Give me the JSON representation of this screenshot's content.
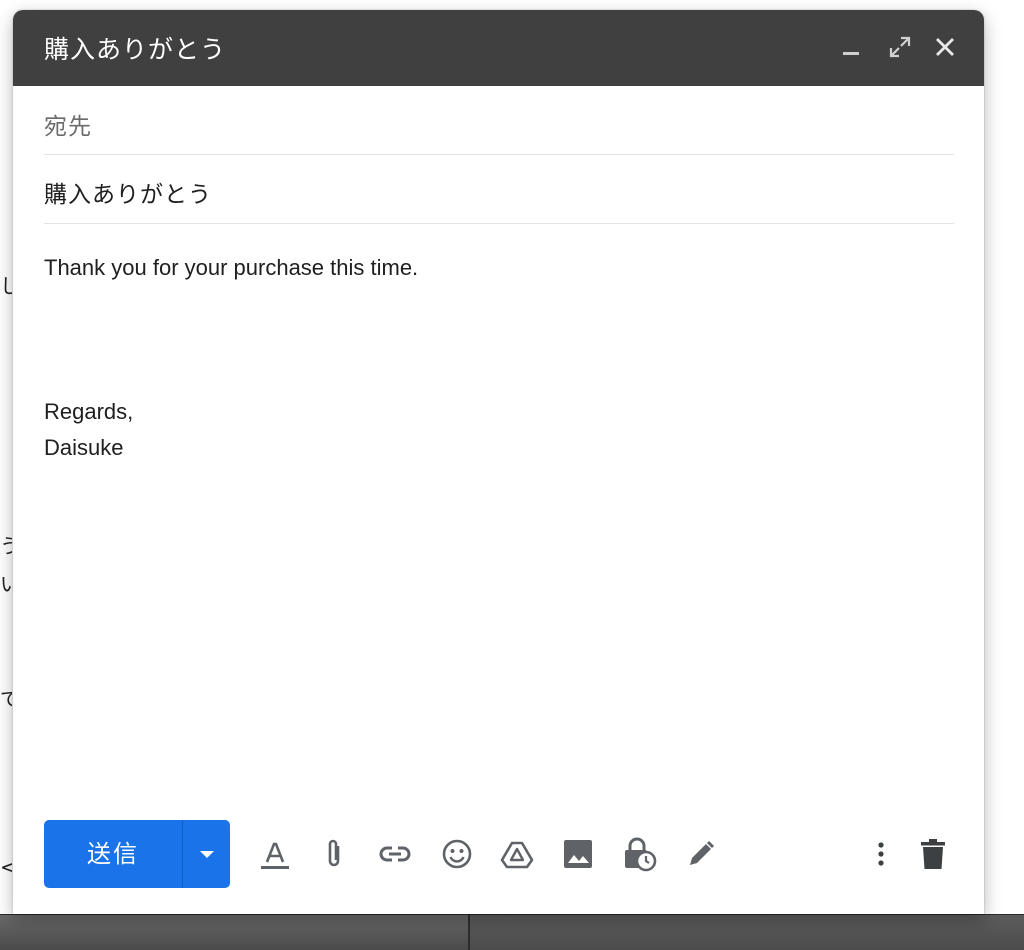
{
  "compose": {
    "title": "購入ありがとう",
    "to_label": "宛先",
    "subject": "購入ありがとう",
    "body_lines": [
      "Thank you for your purchase this time.",
      "Regards,",
      "Daisuke"
    ],
    "send_label": "送信"
  },
  "background_fragments": [
    "し",
    "う",
    "い",
    "で",
    "<"
  ],
  "icons": {
    "minimize": "minimize-icon",
    "expand": "expand-icon",
    "close": "close-icon",
    "send_options": "chevron-down-icon",
    "formatting": "text-format-icon",
    "attach": "paperclip-icon",
    "link": "link-icon",
    "emoji": "emoji-icon",
    "drive": "drive-icon",
    "photo": "photo-icon",
    "confidential": "lock-clock-icon",
    "signature": "pen-icon",
    "more": "more-vert-icon",
    "discard": "trash-icon"
  },
  "colors": {
    "title_bar": "#404040",
    "send_button": "#1a73e8",
    "icon_gray": "#5f6368"
  }
}
